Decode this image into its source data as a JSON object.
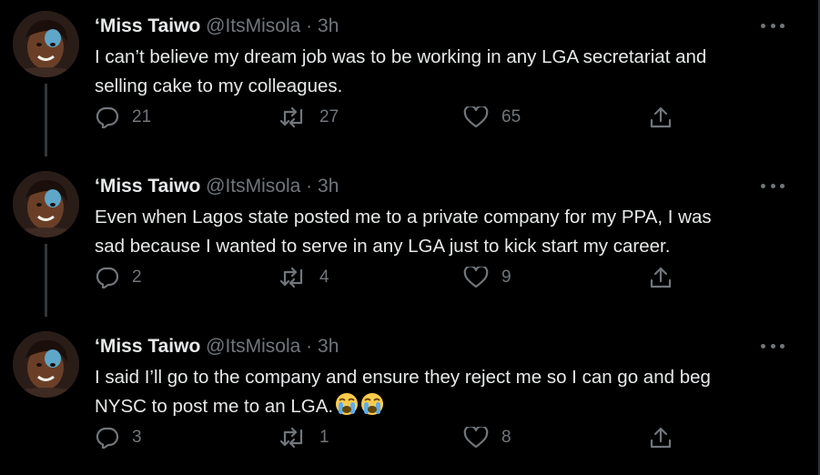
{
  "colors": {
    "background": "#000000",
    "primary_text": "#e7e9ea",
    "secondary_text": "#71767b",
    "thread_line": "#333639"
  },
  "icons": {
    "reply": "speech-bubble-icon",
    "retweet": "retweet-arrows-icon",
    "like": "heart-outline-icon",
    "share": "upload-share-icon",
    "more": "three-dots-icon"
  },
  "tweets": [
    {
      "display_name": "‘Miss Taiwo",
      "handle": "@ItsMisola",
      "separator": "·",
      "time": "3h",
      "text": "I can’t believe my dream job was to be working in any LGA secretariat and\nselling cake to my colleagues.",
      "replies": "21",
      "retweets": "27",
      "likes": "65"
    },
    {
      "display_name": "‘Miss Taiwo",
      "handle": "@ItsMisola",
      "separator": "·",
      "time": "3h",
      "text": "Even when Lagos state posted me to a private company for my PPA, I was\nsad because I wanted to serve in any LGA just to kick start my career.",
      "replies": "2",
      "retweets": "4",
      "likes": "9"
    },
    {
      "display_name": "‘Miss Taiwo",
      "handle": "@ItsMisola",
      "separator": "·",
      "time": "3h",
      "text": "I said I’ll go to the company and ensure they reject me so I can go and beg\nNYSC to post me to an LGA.",
      "emoji": "loudly-crying-face x2",
      "replies": "3",
      "retweets": "1",
      "likes": "8"
    }
  ]
}
